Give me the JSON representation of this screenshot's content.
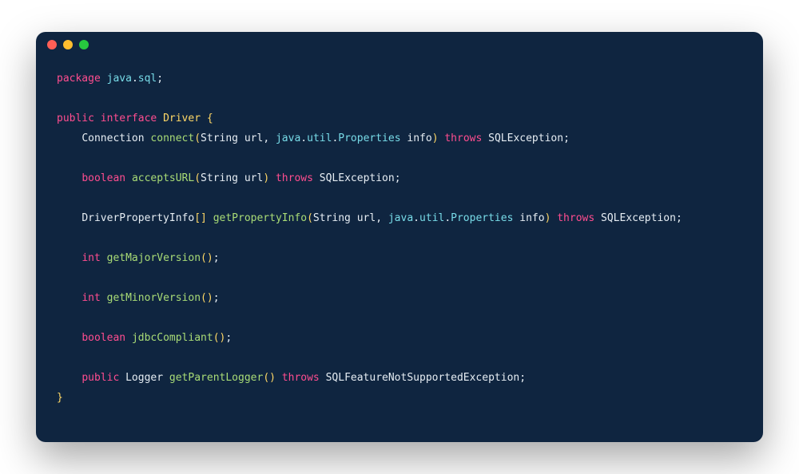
{
  "colors": {
    "background": "#0f2540",
    "keyword": "#ff4d8f",
    "type": "#ffd866",
    "function": "#a9dc76",
    "qualifier": "#78dce8",
    "text": "#e6edf3",
    "traffic_red": "#ff5f56",
    "traffic_yellow": "#ffbd2e",
    "traffic_green": "#27c93f"
  },
  "tokens": {
    "kw_package": "package",
    "pkg_java": "java",
    "pkg_sql": "sql",
    "kw_public": "public",
    "kw_interface": "interface",
    "type_driver": "Driver",
    "type_connection": "Connection",
    "fn_connect": "connect",
    "type_string": "String",
    "id_url": "url",
    "pkg_util": "util",
    "type_properties": "Properties",
    "id_info": "info",
    "kw_throws": "throws",
    "type_sqlexception": "SQLException",
    "kw_boolean": "boolean",
    "fn_acceptsURL": "acceptsURL",
    "type_driverpropinfo": "DriverPropertyInfo",
    "fn_getPropertyInfo": "getPropertyInfo",
    "kw_int": "int",
    "fn_getMajorVersion": "getMajorVersion",
    "fn_getMinorVersion": "getMinorVersion",
    "fn_jdbcCompliant": "jdbcCompliant",
    "type_logger": "Logger",
    "fn_getParentLogger": "getParentLogger",
    "type_sqlfeaturenotsupported": "SQLFeatureNotSupportedException",
    "semi": ";",
    "comma": ",",
    "dot": ".",
    "lbrace": "{",
    "rbrace": "}",
    "lparen": "(",
    "rparen": ")",
    "lbracket": "[",
    "rbracket": "]"
  },
  "plain_source": "package java.sql;\n\npublic interface Driver {\n    Connection connect(String url, java.util.Properties info) throws SQLException;\n\n    boolean acceptsURL(String url) throws SQLException;\n\n    DriverPropertyInfo[] getPropertyInfo(String url, java.util.Properties info) throws SQLException;\n\n    int getMajorVersion();\n\n    int getMinorVersion();\n\n    boolean jdbcCompliant();\n\n    public Logger getParentLogger() throws SQLFeatureNotSupportedException;\n}"
}
